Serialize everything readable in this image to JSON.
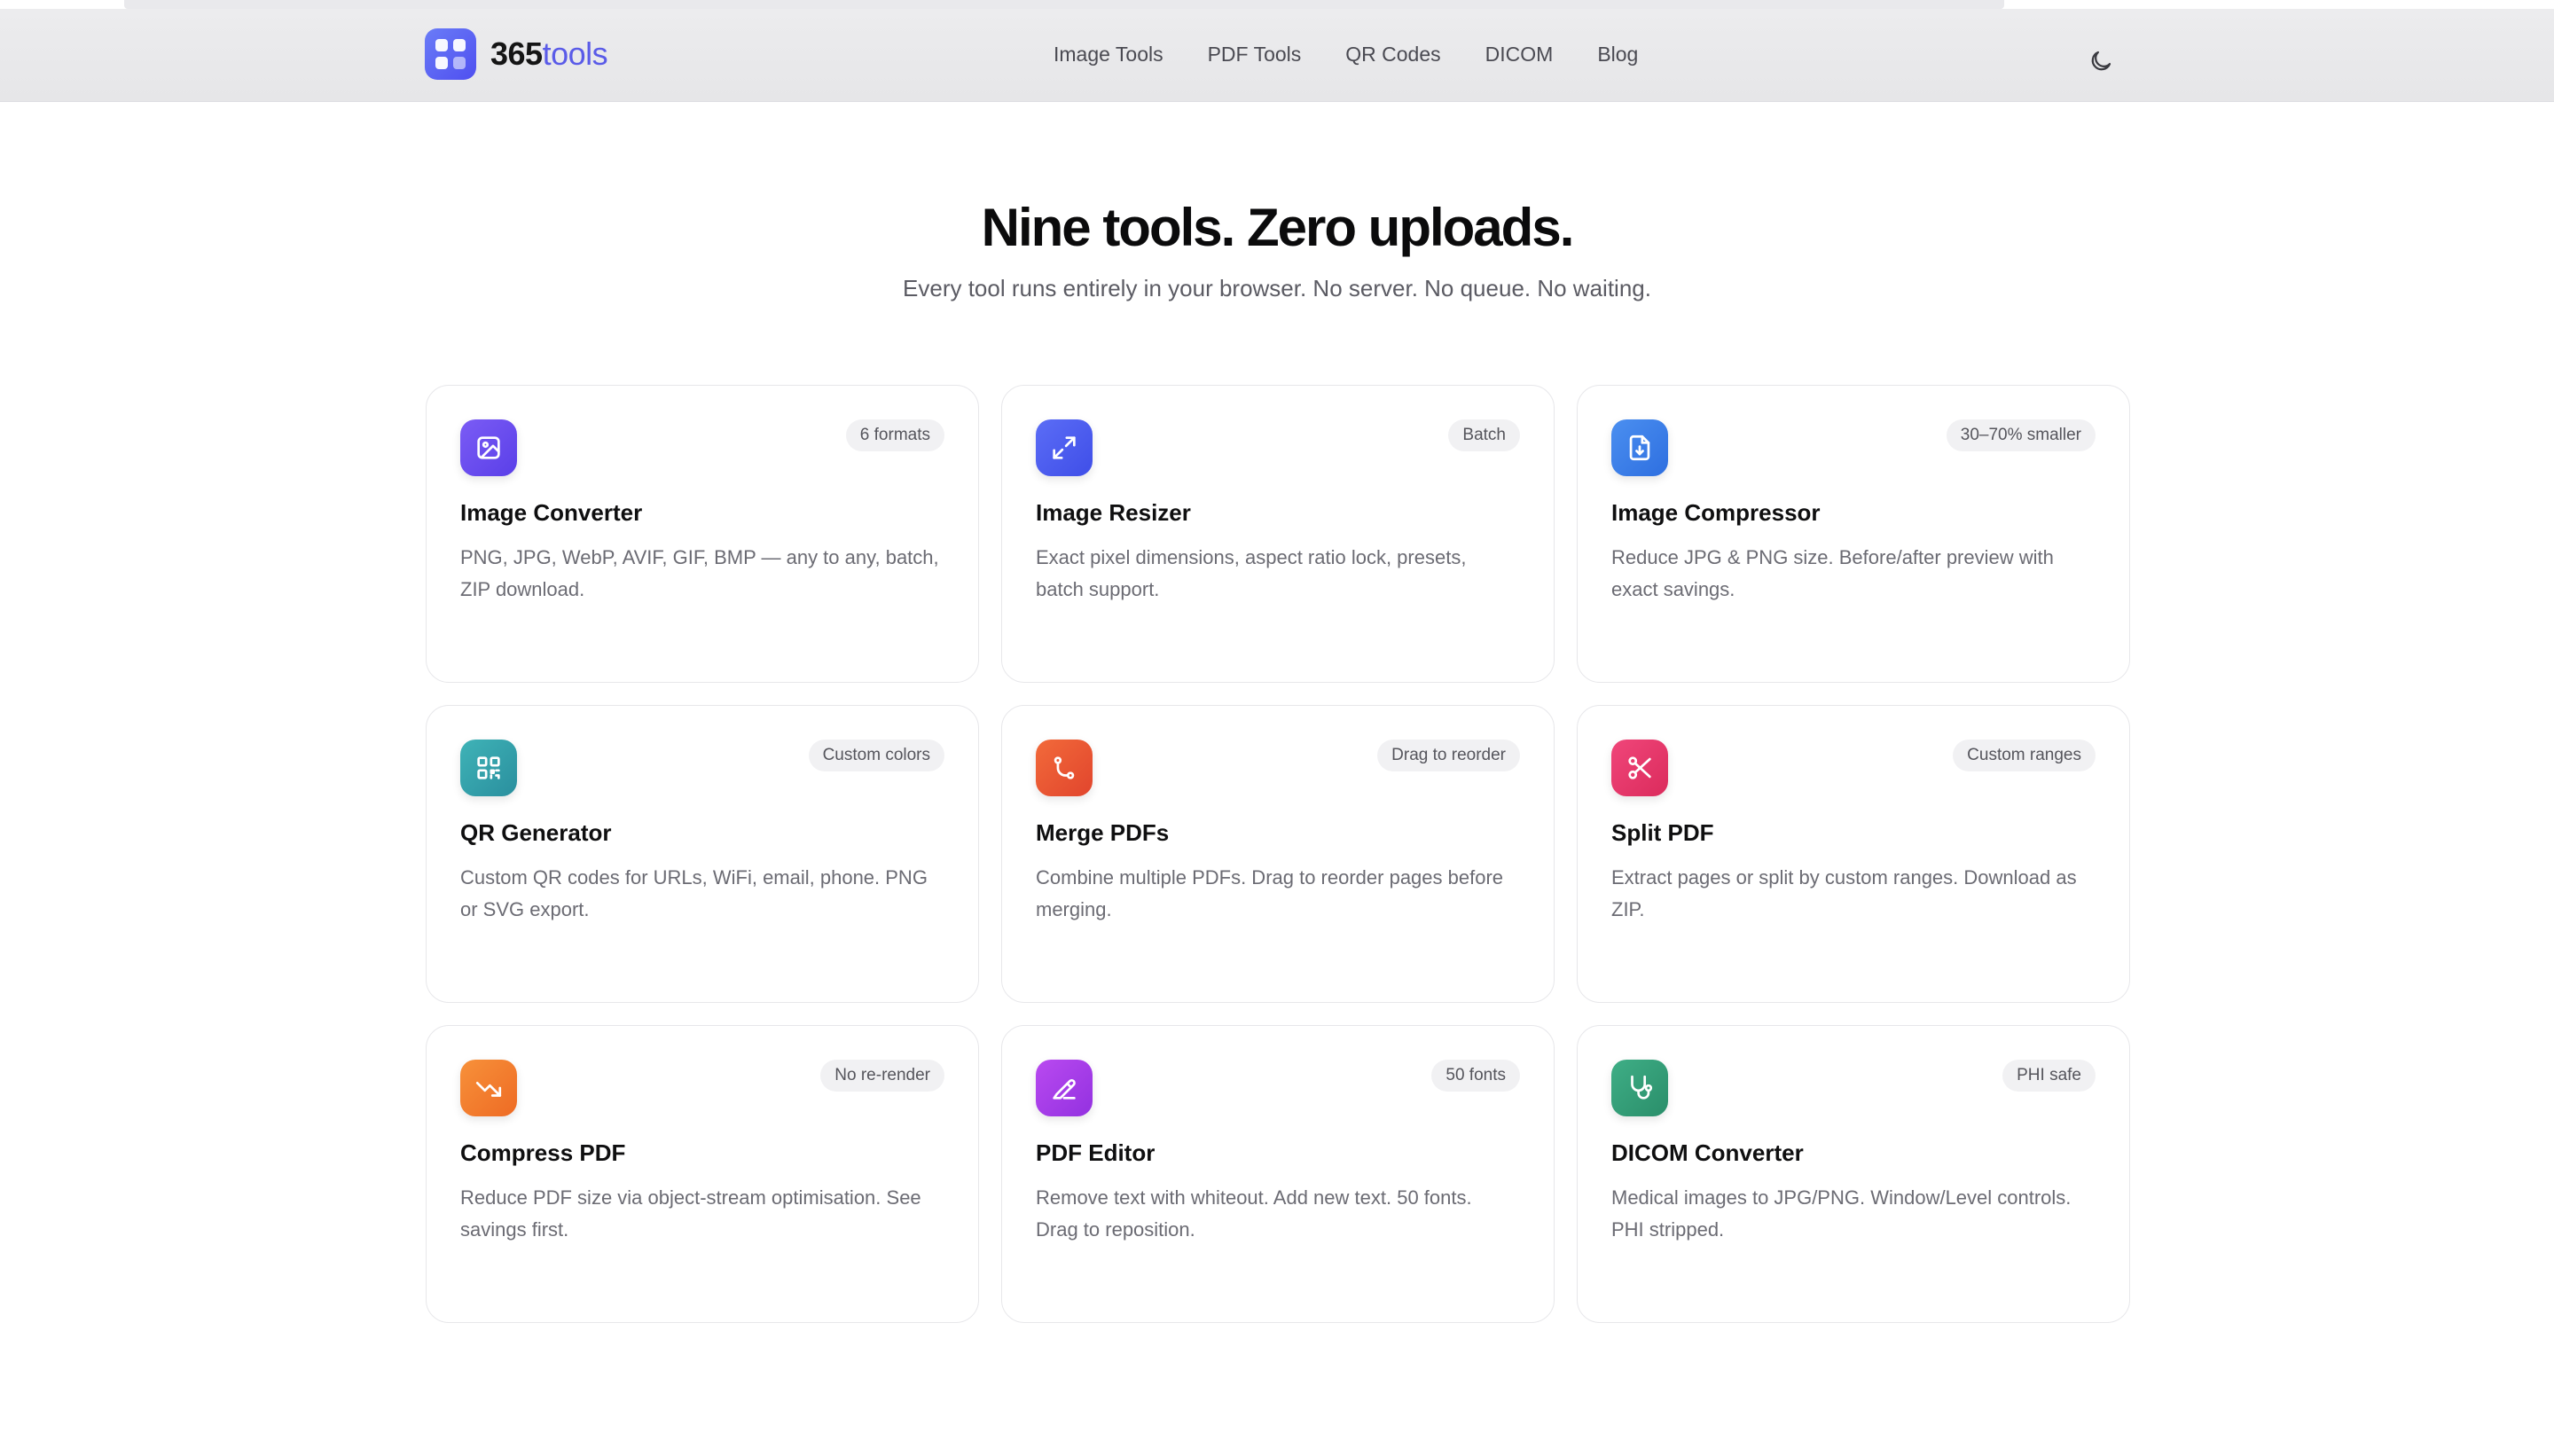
{
  "brand": {
    "num": "365",
    "word": "tools"
  },
  "nav": [
    "Image Tools",
    "PDF Tools",
    "QR Codes",
    "DICOM",
    "Blog"
  ],
  "theme_icon": "moon-icon",
  "hero": {
    "title": "Nine tools. Zero uploads.",
    "subtitle": "Every tool runs entirely in your browser. No server. No queue. No waiting."
  },
  "tools": [
    {
      "name": "image-converter",
      "icon": "image-icon",
      "gradient": [
        "#7b5cf5",
        "#5a3fe8"
      ],
      "badge": "6 formats",
      "title": "Image Converter",
      "desc": "PNG, JPG, WebP, AVIF, GIF, BMP — any to any, batch, ZIP download."
    },
    {
      "name": "image-resizer",
      "icon": "expand-icon",
      "gradient": [
        "#5b6df6",
        "#3f4ee8"
      ],
      "badge": "Batch",
      "title": "Image Resizer",
      "desc": "Exact pixel dimensions, aspect ratio lock, presets, batch support."
    },
    {
      "name": "image-compressor",
      "icon": "file-download-icon",
      "gradient": [
        "#4b8ff0",
        "#2e6fe0"
      ],
      "badge": "30–70% smaller",
      "title": "Image Compressor",
      "desc": "Reduce JPG & PNG size. Before/after preview with exact savings."
    },
    {
      "name": "qr-generator",
      "icon": "qr-code-icon",
      "gradient": [
        "#3fb3b7",
        "#2a8f9e"
      ],
      "badge": "Custom colors",
      "title": "QR Generator",
      "desc": "Custom QR codes for URLs, WiFi, email, phone. PNG or SVG export."
    },
    {
      "name": "merge-pdfs",
      "icon": "merge-icon",
      "gradient": [
        "#f26a3a",
        "#e1452d"
      ],
      "badge": "Drag to reorder",
      "title": "Merge PDFs",
      "desc": "Combine multiple PDFs. Drag to reorder pages before merging."
    },
    {
      "name": "split-pdf",
      "icon": "scissors-icon",
      "gradient": [
        "#f0467a",
        "#db2b5c"
      ],
      "badge": "Custom ranges",
      "title": "Split PDF",
      "desc": "Extract pages or split by custom ranges. Download as ZIP."
    },
    {
      "name": "compress-pdf",
      "icon": "trend-down-icon",
      "gradient": [
        "#f7913a",
        "#ee6b24"
      ],
      "badge": "No re-render",
      "title": "Compress PDF",
      "desc": "Reduce PDF size via object-stream optimisation. See savings first."
    },
    {
      "name": "pdf-editor",
      "icon": "pen-icon",
      "gradient": [
        "#b94af0",
        "#9331e0"
      ],
      "badge": "50 fonts",
      "title": "PDF Editor",
      "desc": "Remove text with whiteout. Add new text. 50 fonts. Drag to reposition."
    },
    {
      "name": "dicom-converter",
      "icon": "stethoscope-icon",
      "gradient": [
        "#3fae86",
        "#2a8e6a"
      ],
      "badge": "PHI safe",
      "title": "DICOM Converter",
      "desc": "Medical images to JPG/PNG. Window/Level controls. PHI stripped."
    }
  ]
}
